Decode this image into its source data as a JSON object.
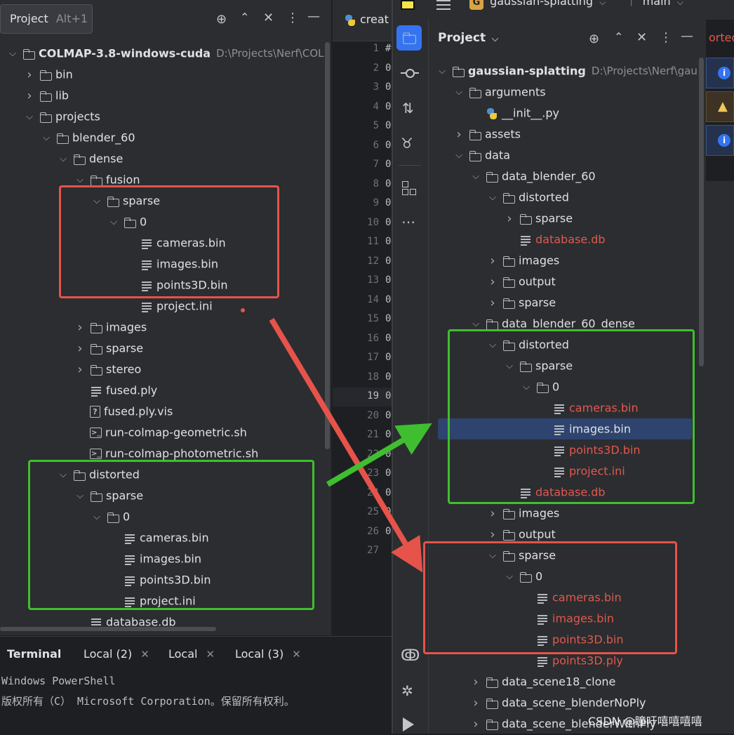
{
  "tooltip": {
    "title": "Project",
    "shortcut": "Alt+1"
  },
  "left_tree": [
    {
      "depth": 0,
      "kind": "folder",
      "open": true,
      "label": "COLMAP-3.8-windows-cuda",
      "hint": "D:\\Projects\\Nerf\\COL",
      "bold": true
    },
    {
      "depth": 1,
      "kind": "folder",
      "open": false,
      "label": "bin"
    },
    {
      "depth": 1,
      "kind": "folder",
      "open": false,
      "label": "lib"
    },
    {
      "depth": 1,
      "kind": "folder",
      "open": true,
      "label": "projects"
    },
    {
      "depth": 2,
      "kind": "folder",
      "open": true,
      "label": "blender_60"
    },
    {
      "depth": 3,
      "kind": "folder",
      "open": true,
      "label": "dense"
    },
    {
      "depth": 4,
      "kind": "folder",
      "open": true,
      "label": "fusion"
    },
    {
      "depth": 5,
      "kind": "folder",
      "open": true,
      "label": "sparse"
    },
    {
      "depth": 6,
      "kind": "folder",
      "open": true,
      "label": "0"
    },
    {
      "depth": 7,
      "kind": "file",
      "label": "cameras.bin"
    },
    {
      "depth": 7,
      "kind": "file",
      "label": "images.bin"
    },
    {
      "depth": 7,
      "kind": "file",
      "label": "points3D.bin"
    },
    {
      "depth": 7,
      "kind": "file",
      "label": "project.ini"
    },
    {
      "depth": 4,
      "kind": "folder",
      "open": false,
      "label": "images"
    },
    {
      "depth": 4,
      "kind": "folder",
      "open": false,
      "label": "sparse"
    },
    {
      "depth": 4,
      "kind": "folder",
      "open": false,
      "label": "stereo"
    },
    {
      "depth": 4,
      "kind": "file",
      "label": "fused.ply"
    },
    {
      "depth": 4,
      "kind": "unknown",
      "label": "fused.ply.vis"
    },
    {
      "depth": 4,
      "kind": "shell",
      "label": "run-colmap-geometric.sh"
    },
    {
      "depth": 4,
      "kind": "shell",
      "label": "run-colmap-photometric.sh"
    },
    {
      "depth": 3,
      "kind": "folder",
      "open": true,
      "label": "distorted"
    },
    {
      "depth": 4,
      "kind": "folder",
      "open": true,
      "label": "sparse"
    },
    {
      "depth": 5,
      "kind": "folder",
      "open": true,
      "label": "0"
    },
    {
      "depth": 6,
      "kind": "file",
      "label": "cameras.bin"
    },
    {
      "depth": 6,
      "kind": "file",
      "label": "images.bin"
    },
    {
      "depth": 6,
      "kind": "file",
      "label": "points3D.bin"
    },
    {
      "depth": 6,
      "kind": "file",
      "label": "project.ini"
    },
    {
      "depth": 4,
      "kind": "file",
      "label": "database.db"
    }
  ],
  "editor": {
    "tab_label": "creat",
    "line_numbers": [
      "1",
      "2",
      "3",
      "4",
      "5",
      "6",
      "7",
      "8",
      "9",
      "10",
      "11",
      "12",
      "13",
      "14",
      "15",
      "16",
      "17",
      "18",
      "19",
      "20",
      "21",
      "22",
      "23",
      "24",
      "25",
      "26",
      "27"
    ],
    "first_char": [
      "#",
      "0",
      "0",
      "0",
      "0",
      "0",
      "0",
      "0",
      "0",
      "0",
      "0",
      "0",
      "0",
      "0",
      "0",
      "0",
      "0",
      "0",
      "0",
      "0",
      "0",
      "0",
      "0",
      "0",
      "0",
      "0",
      ""
    ]
  },
  "terminal": {
    "title": "Terminal",
    "tabs": [
      {
        "label": "Local (2)"
      },
      {
        "label": "Local"
      },
      {
        "label": "Local (3)"
      }
    ],
    "lines": [
      "Windows PowerShell",
      "版权所有（C） Microsoft Corporation。保留所有权利。"
    ]
  },
  "right_window": {
    "project_letter": "G",
    "project_name": "gaussian-splatting",
    "branch": "main",
    "panel_title": "Project",
    "tab_fragment": "orted"
  },
  "right_tree": [
    {
      "depth": 0,
      "kind": "folder",
      "open": true,
      "label": "gaussian-splatting",
      "hint": "D:\\Projects\\Nerf\\gau",
      "bold": true
    },
    {
      "depth": 1,
      "kind": "pkg",
      "open": true,
      "label": "arguments"
    },
    {
      "depth": 2,
      "kind": "py",
      "label": "__init__.py"
    },
    {
      "depth": 1,
      "kind": "folder",
      "open": false,
      "label": "assets"
    },
    {
      "depth": 1,
      "kind": "folder",
      "open": true,
      "label": "data"
    },
    {
      "depth": 2,
      "kind": "folder",
      "open": true,
      "label": "data_blender_60"
    },
    {
      "depth": 3,
      "kind": "folder",
      "open": true,
      "label": "distorted"
    },
    {
      "depth": 4,
      "kind": "folder",
      "open": false,
      "label": "sparse"
    },
    {
      "depth": 4,
      "kind": "file",
      "label": "database.db",
      "red": true
    },
    {
      "depth": 3,
      "kind": "folder",
      "open": false,
      "label": "images"
    },
    {
      "depth": 3,
      "kind": "folder",
      "open": false,
      "label": "output"
    },
    {
      "depth": 3,
      "kind": "folder",
      "open": false,
      "label": "sparse"
    },
    {
      "depth": 2,
      "kind": "folder",
      "open": true,
      "label": "data_blender_60_dense"
    },
    {
      "depth": 3,
      "kind": "folder",
      "open": true,
      "label": "distorted"
    },
    {
      "depth": 4,
      "kind": "folder",
      "open": true,
      "label": "sparse"
    },
    {
      "depth": 5,
      "kind": "folder",
      "open": true,
      "label": "0"
    },
    {
      "depth": 6,
      "kind": "file",
      "label": "cameras.bin",
      "red": true
    },
    {
      "depth": 6,
      "kind": "file",
      "label": "images.bin",
      "selected": true
    },
    {
      "depth": 6,
      "kind": "file",
      "label": "points3D.bin",
      "red": true
    },
    {
      "depth": 6,
      "kind": "file",
      "label": "project.ini",
      "red": true
    },
    {
      "depth": 4,
      "kind": "file",
      "label": "database.db",
      "red": true
    },
    {
      "depth": 3,
      "kind": "folder",
      "open": false,
      "label": "images"
    },
    {
      "depth": 3,
      "kind": "folder",
      "open": false,
      "label": "output"
    },
    {
      "depth": 3,
      "kind": "folder",
      "open": true,
      "label": "sparse"
    },
    {
      "depth": 4,
      "kind": "folder",
      "open": true,
      "label": "0"
    },
    {
      "depth": 5,
      "kind": "file",
      "label": "cameras.bin",
      "red": true
    },
    {
      "depth": 5,
      "kind": "file",
      "label": "images.bin",
      "red": true
    },
    {
      "depth": 5,
      "kind": "file",
      "label": "points3D.bin",
      "red": true
    },
    {
      "depth": 5,
      "kind": "file",
      "label": "points3D.ply",
      "red": true
    },
    {
      "depth": 2,
      "kind": "folder",
      "open": false,
      "label": "data_scene18_clone"
    },
    {
      "depth": 2,
      "kind": "folder",
      "open": false,
      "label": "data_scene_blenderNoPly"
    },
    {
      "depth": 2,
      "kind": "folder",
      "open": false,
      "label": "data_scene_blenderWithPly"
    }
  ],
  "watermark": "CSDN @瞳吁嘻嘻嘻嘻",
  "colors": {
    "red_box": "#e5534b",
    "green_box": "#3fbf2f",
    "accent": "#3574f0",
    "vcs_red": "#e2584e"
  }
}
